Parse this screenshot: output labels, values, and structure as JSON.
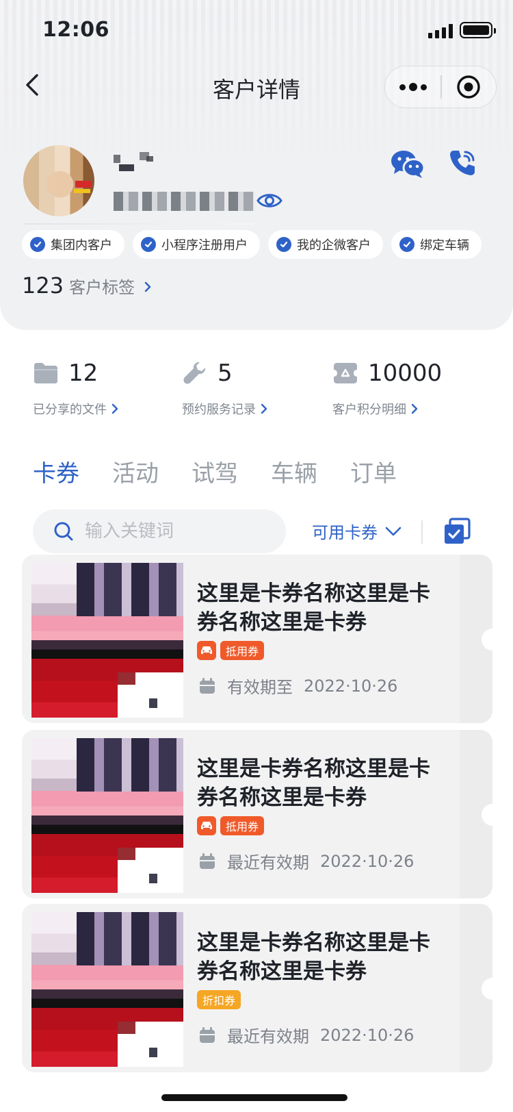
{
  "status_bar": {
    "time": "12:06"
  },
  "nav": {
    "title": "客户详情"
  },
  "profile": {
    "tags": [
      {
        "label": "集团内客户"
      },
      {
        "label": "小程序注册用户"
      },
      {
        "label": "我的企微客户"
      },
      {
        "label": "绑定车辆"
      }
    ],
    "tag_count": "123",
    "tag_count_label": "客户标签"
  },
  "stats": [
    {
      "value": "12",
      "label": "已分享的文件",
      "icon": "folder-icon"
    },
    {
      "value": "5",
      "label": "预约服务记录",
      "icon": "wrench-icon"
    },
    {
      "value": "10000",
      "label": "客户积分明细",
      "icon": "points-icon"
    }
  ],
  "tabs": [
    {
      "label": "卡券",
      "active": true
    },
    {
      "label": "活动",
      "active": false
    },
    {
      "label": "试驾",
      "active": false
    },
    {
      "label": "车辆",
      "active": false
    },
    {
      "label": "订单",
      "active": false
    }
  ],
  "search": {
    "placeholder": "输入关键词",
    "value": ""
  },
  "filter": {
    "label": "可用卡券"
  },
  "coupons": [
    {
      "title": "这里是卡券名称这里是卡券名称这里是卡券",
      "type": "抵用券",
      "show_car": true,
      "validity_label": "有效期至",
      "date": "2022·10·26"
    },
    {
      "title": "这里是卡券名称这里是卡券名称这里是卡券",
      "type": "抵用券",
      "show_car": true,
      "validity_label": "最近有效期",
      "date": "2022·10·26"
    },
    {
      "title": "这里是卡券名称这里是卡券名称这里是卡券",
      "type": "折扣券",
      "show_car": false,
      "validity_label": "最近有效期",
      "date": "2022·10·26"
    }
  ],
  "colors": {
    "accent": "#2f62c8",
    "badge_orange": "#f05a2a",
    "badge_gold": "#f5a623"
  }
}
